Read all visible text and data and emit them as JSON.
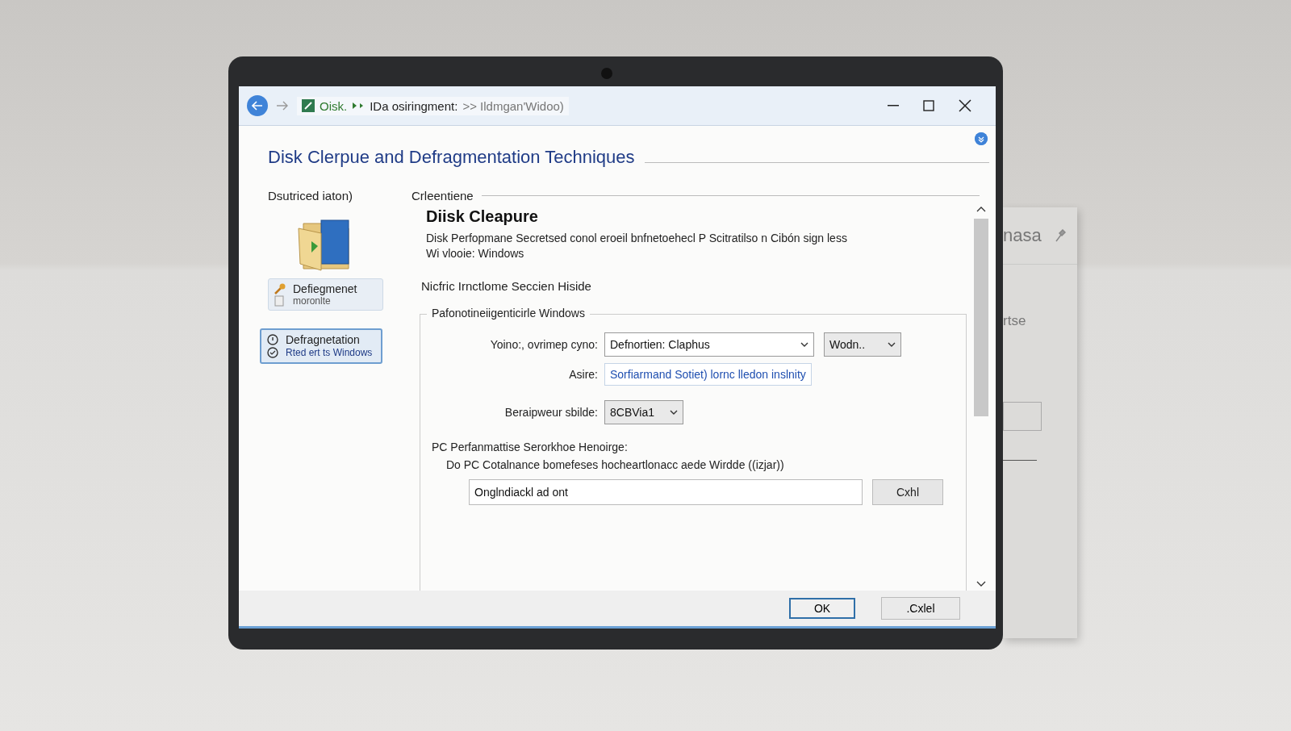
{
  "back_panel": {
    "title": "nasa",
    "text": "rtse"
  },
  "window": {
    "breadcrumb": [
      {
        "text": "Oisk.",
        "kind": "root"
      },
      {
        "text": "IDa osiringment:",
        "kind": "path"
      },
      {
        "text": ">> Ildmgan'Widoo)",
        "kind": "hint"
      }
    ],
    "title": "Disk Clerpue and Defragmentation Techniques"
  },
  "sidebar": {
    "heading": "Dsutriced iaton)",
    "items": [
      {
        "title": "Defiegmenet",
        "subtitle": "moronlte",
        "selected": false
      },
      {
        "title": "Defragnetation",
        "subtitle": "Rted ert ts Windows",
        "selected": true
      }
    ]
  },
  "content": {
    "section": "Crleentiene",
    "heading": "Diisk Cleapure",
    "description": "Disk Perfopmane Secretsed conol eroeil bnfnetoehecl P Scitratilso n Cibón sign less\nWi vlooie: Windows",
    "note": "Nicfric Irnctlome Seccien Hiside",
    "group": {
      "legend": "Pafonotineiigenticirle Windows",
      "rows": [
        {
          "label": "Yoino:, ovrimep cyno:",
          "kind": "dropdown",
          "value": "Defnortien: Claphus",
          "extra": "Wodn.."
        },
        {
          "label": "Asire:",
          "kind": "link",
          "value": "Sorfiarmand Sotiet) lornc lledon inslnity"
        },
        {
          "label": "Beraipweur sbilde:",
          "kind": "small-dropdown",
          "value": "8CBVia1"
        }
      ],
      "caption": "PC Perfanmattise Serorkhoe Henoirge:",
      "caption_detail": "Do PC Cotalnance bomefeses hocheartlonacc aede Wirdde ((izjar))",
      "field_value": "Onglndiackl ad ont",
      "field_button": "Cxhl"
    }
  },
  "footer": {
    "ok": "OK",
    "cancel": ".Cxlel"
  }
}
